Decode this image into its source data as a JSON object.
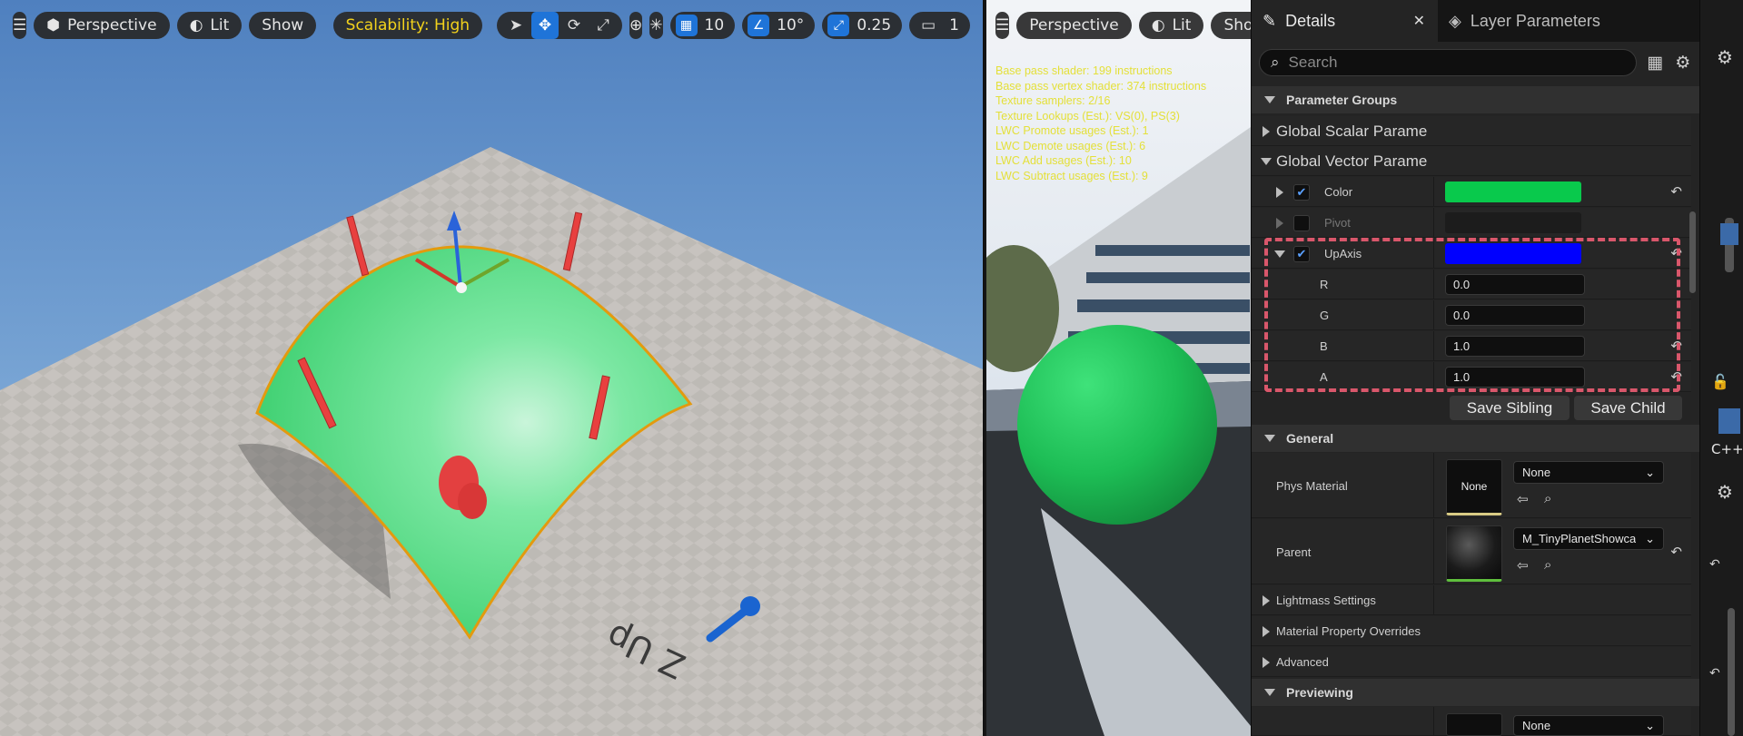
{
  "left_viewport": {
    "menu_icon": "hamburger-icon",
    "perspective_label": "Perspective",
    "lit_label": "Lit",
    "show_label": "Show",
    "scalability_label": "Scalability: High",
    "grid_snap_value": "10",
    "rotation_snap_value": "10°",
    "scale_snap_value": "0.25",
    "camera_speed_value": "1",
    "scene_text": "Z Up"
  },
  "mid_viewport": {
    "perspective_label": "Perspective",
    "lit_label": "Lit",
    "show_label": "Show",
    "stats": [
      "Base pass shader: 199 instructions",
      "Base pass vertex shader: 374 instructions",
      "Texture samplers: 2/16",
      "Texture Lookups (Est.): VS(0), PS(3)",
      "LWC Promote usages (Est.): 1",
      "LWC Demote usages (Est.): 6",
      "LWC Add usages (Est.): 10",
      "LWC Subtract usages (Est.): 9"
    ]
  },
  "details": {
    "tab_details": "Details",
    "tab_layer_params": "Layer Parameters",
    "search_placeholder": "Search",
    "parameter_groups_header": "Parameter Groups",
    "global_scalar_label": "Global Scalar Parame",
    "global_vector_label": "Global Vector Parame",
    "params": {
      "color": {
        "label": "Color",
        "checked": true,
        "swatch": "#09c94c"
      },
      "pivot": {
        "label": "Pivot",
        "checked": false,
        "swatch": "#1c1c1c"
      },
      "upaxis": {
        "label": "UpAxis",
        "checked": true,
        "swatch": "#0000ff"
      }
    },
    "channels": [
      {
        "label": "R",
        "value": "0.0"
      },
      {
        "label": "G",
        "value": "0.0"
      },
      {
        "label": "B",
        "value": "1.0"
      },
      {
        "label": "A",
        "value": "1.0"
      }
    ],
    "save_sibling": "Save Sibling",
    "save_child": "Save Child",
    "general_header": "General",
    "phys_material_label": "Phys Material",
    "phys_thumb_text": "None",
    "phys_combo_value": "None",
    "parent_label": "Parent",
    "parent_combo_value": "M_TinyPlanetShowca",
    "lightmass_label": "Lightmass Settings",
    "overrides_label": "Material Property Overrides",
    "advanced_label": "Advanced",
    "previewing_header": "Previewing",
    "preview_combo_value": "None"
  },
  "right_strip": {
    "cpp_label": "C++"
  },
  "colors": {
    "accent_blue": "#1f74d8",
    "scalability_yellow": "#f3d21c",
    "stats_yellow": "#e4e03a",
    "highlight_dash": "#d9576b"
  }
}
